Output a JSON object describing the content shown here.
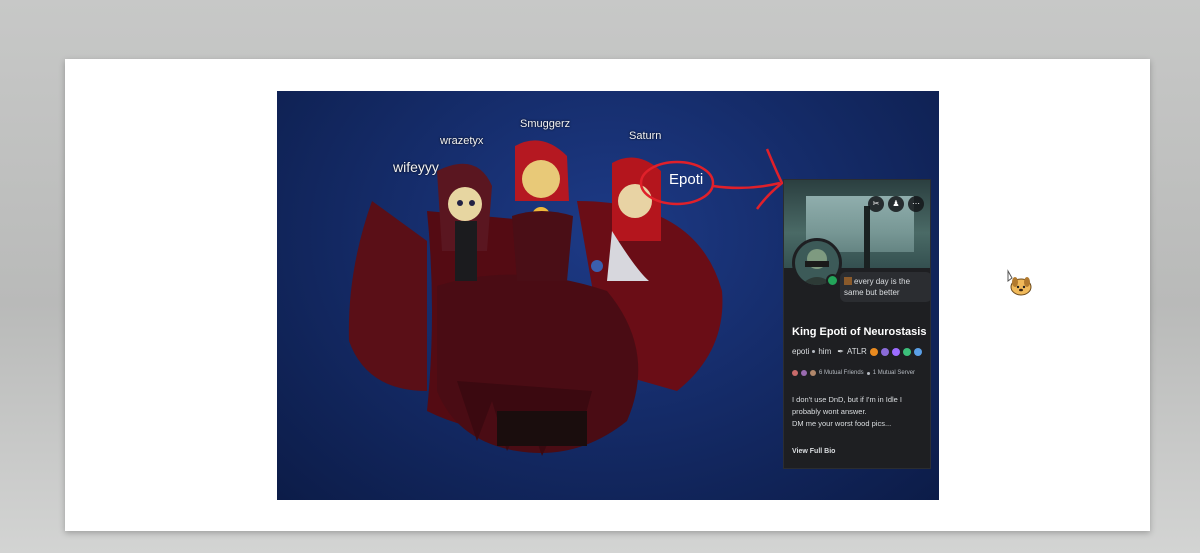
{
  "scene": {
    "nametags": [
      {
        "text": "wifeyyy"
      },
      {
        "text": "wrazetyx"
      },
      {
        "text": "Smuggerz"
      },
      {
        "text": "Saturn"
      }
    ],
    "annotation": {
      "label": "Epoti",
      "color": "#e0202a"
    }
  },
  "profile_card": {
    "actions": [
      {
        "icon": "scissors-icon",
        "glyph": "✂"
      },
      {
        "icon": "add-friend-icon",
        "glyph": "♟"
      },
      {
        "icon": "more-icon",
        "glyph": "⋯"
      }
    ],
    "status": "every day is the same but better",
    "display_name": "King Epoti of Neurostasis",
    "username": "epoti",
    "pronouns": "him",
    "clan_tag": "ATLR",
    "badges": [
      "#e98a1f",
      "#8a6bd8",
      "#9c6cff",
      "#3cbf7a",
      "#5a9fe6"
    ],
    "mutual_friends": "6 Mutual Friends",
    "mutual_servers": "1 Mutual Server",
    "bio": [
      "I don't use DnD, but if I'm in Idle I probably wont answer.",
      "DM me your worst food pics..."
    ],
    "view_full_bio": "View Full Bio",
    "online_color": "#23a55a"
  }
}
